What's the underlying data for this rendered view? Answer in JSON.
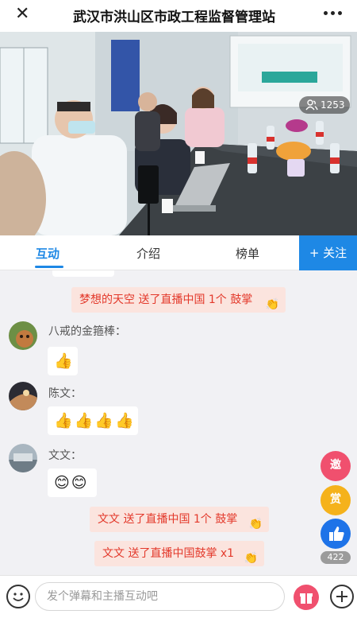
{
  "header": {
    "title": "武汉市洪山区市政工程监督管理站"
  },
  "live": {
    "viewer_count": "1253"
  },
  "tabs": [
    {
      "label": "互动",
      "active": true
    },
    {
      "label": "介绍",
      "active": false
    },
    {
      "label": "榜单",
      "active": false
    }
  ],
  "follow_label": "+ 关注",
  "messages": {
    "gift_1": "梦想的天空 送了直播中国 1个 鼓掌",
    "user_1": {
      "name": "八戒的金箍棒：",
      "emoji": "👍"
    },
    "user_2": {
      "name": "陈文：",
      "emoji": "👍👍👍👍"
    },
    "user_3": {
      "name": "文文：",
      "emoji": "😊😊"
    },
    "gift_2": "文文 送了直播中国 1个 鼓掌",
    "gift_3": "文文 送了直播中国鼓掌 x1"
  },
  "side": {
    "invite_label": "邀",
    "reward_label": "赏",
    "like_count": "422"
  },
  "input": {
    "placeholder": "发个弹幕和主播互动吧"
  },
  "colors": {
    "accent": "#1e88e5",
    "gift_text": "#e3392b",
    "gift_bg": "#fbe4de"
  }
}
